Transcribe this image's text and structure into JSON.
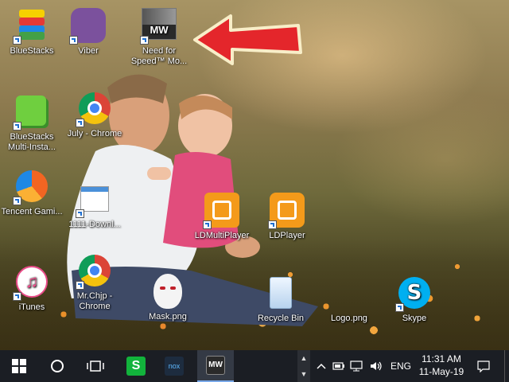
{
  "desktop": {
    "icons": [
      {
        "id": "bluestacks",
        "label": "BlueStacks",
        "icon": "bluestacks-icon"
      },
      {
        "id": "viber",
        "label": "Viber",
        "icon": "viber-icon"
      },
      {
        "id": "nfs",
        "label": "Need for Speed™ Mo...",
        "icon": "need-for-speed-icon",
        "thumb_text": "MW"
      },
      {
        "id": "bluestacks-multi",
        "label": "BlueStacks Multi-Insta...",
        "icon": "bluestacks-multi-instance-icon"
      },
      {
        "id": "july-chrome",
        "label": "July - Chrome",
        "icon": "chrome-icon"
      },
      {
        "id": "tencent",
        "label": "Tencent Gami...",
        "icon": "tencent-gaming-icon"
      },
      {
        "id": "download",
        "label": "1111-Downl...",
        "icon": "image-file-icon"
      },
      {
        "id": "ldmulti",
        "label": "LDMultiPlayer",
        "icon": "ldmultiplayer-icon"
      },
      {
        "id": "ldplayer",
        "label": "LDPlayer",
        "icon": "ldplayer-icon"
      },
      {
        "id": "itunes",
        "label": "iTunes",
        "icon": "itunes-icon",
        "glyph": "♫"
      },
      {
        "id": "mrchip-chrome",
        "label": "Mr.Chjp - Chrome",
        "icon": "chrome-icon"
      },
      {
        "id": "mask",
        "label": "Mask.png",
        "icon": "mask-image-icon"
      },
      {
        "id": "recycle-bin",
        "label": "Recycle Bin",
        "icon": "recycle-bin-icon"
      },
      {
        "id": "logo",
        "label": "Logo.png",
        "icon": "logo-image-icon"
      },
      {
        "id": "skype",
        "label": "Skype",
        "icon": "skype-icon",
        "glyph": "S"
      }
    ]
  },
  "taskbar": {
    "pinned": [
      {
        "name": "start-button",
        "icon": "windows-logo-icon"
      },
      {
        "name": "search-button",
        "icon": "cortana-circle-icon"
      },
      {
        "name": "task-view-button",
        "icon": "task-view-icon"
      },
      {
        "name": "taskbar-app-s",
        "icon": "green-s-app-icon",
        "color": "#12b33c"
      },
      {
        "name": "taskbar-app-nox",
        "icon": "nox-icon",
        "text": "nox"
      },
      {
        "name": "taskbar-app-nfs",
        "icon": "need-for-speed-icon",
        "text": "MW"
      }
    ],
    "tray": {
      "language": "ENG",
      "time": "11:31 AM",
      "date": "11-May-19"
    }
  },
  "colors": {
    "taskbar": "#1b1e24",
    "arrow": "#e4262b"
  }
}
